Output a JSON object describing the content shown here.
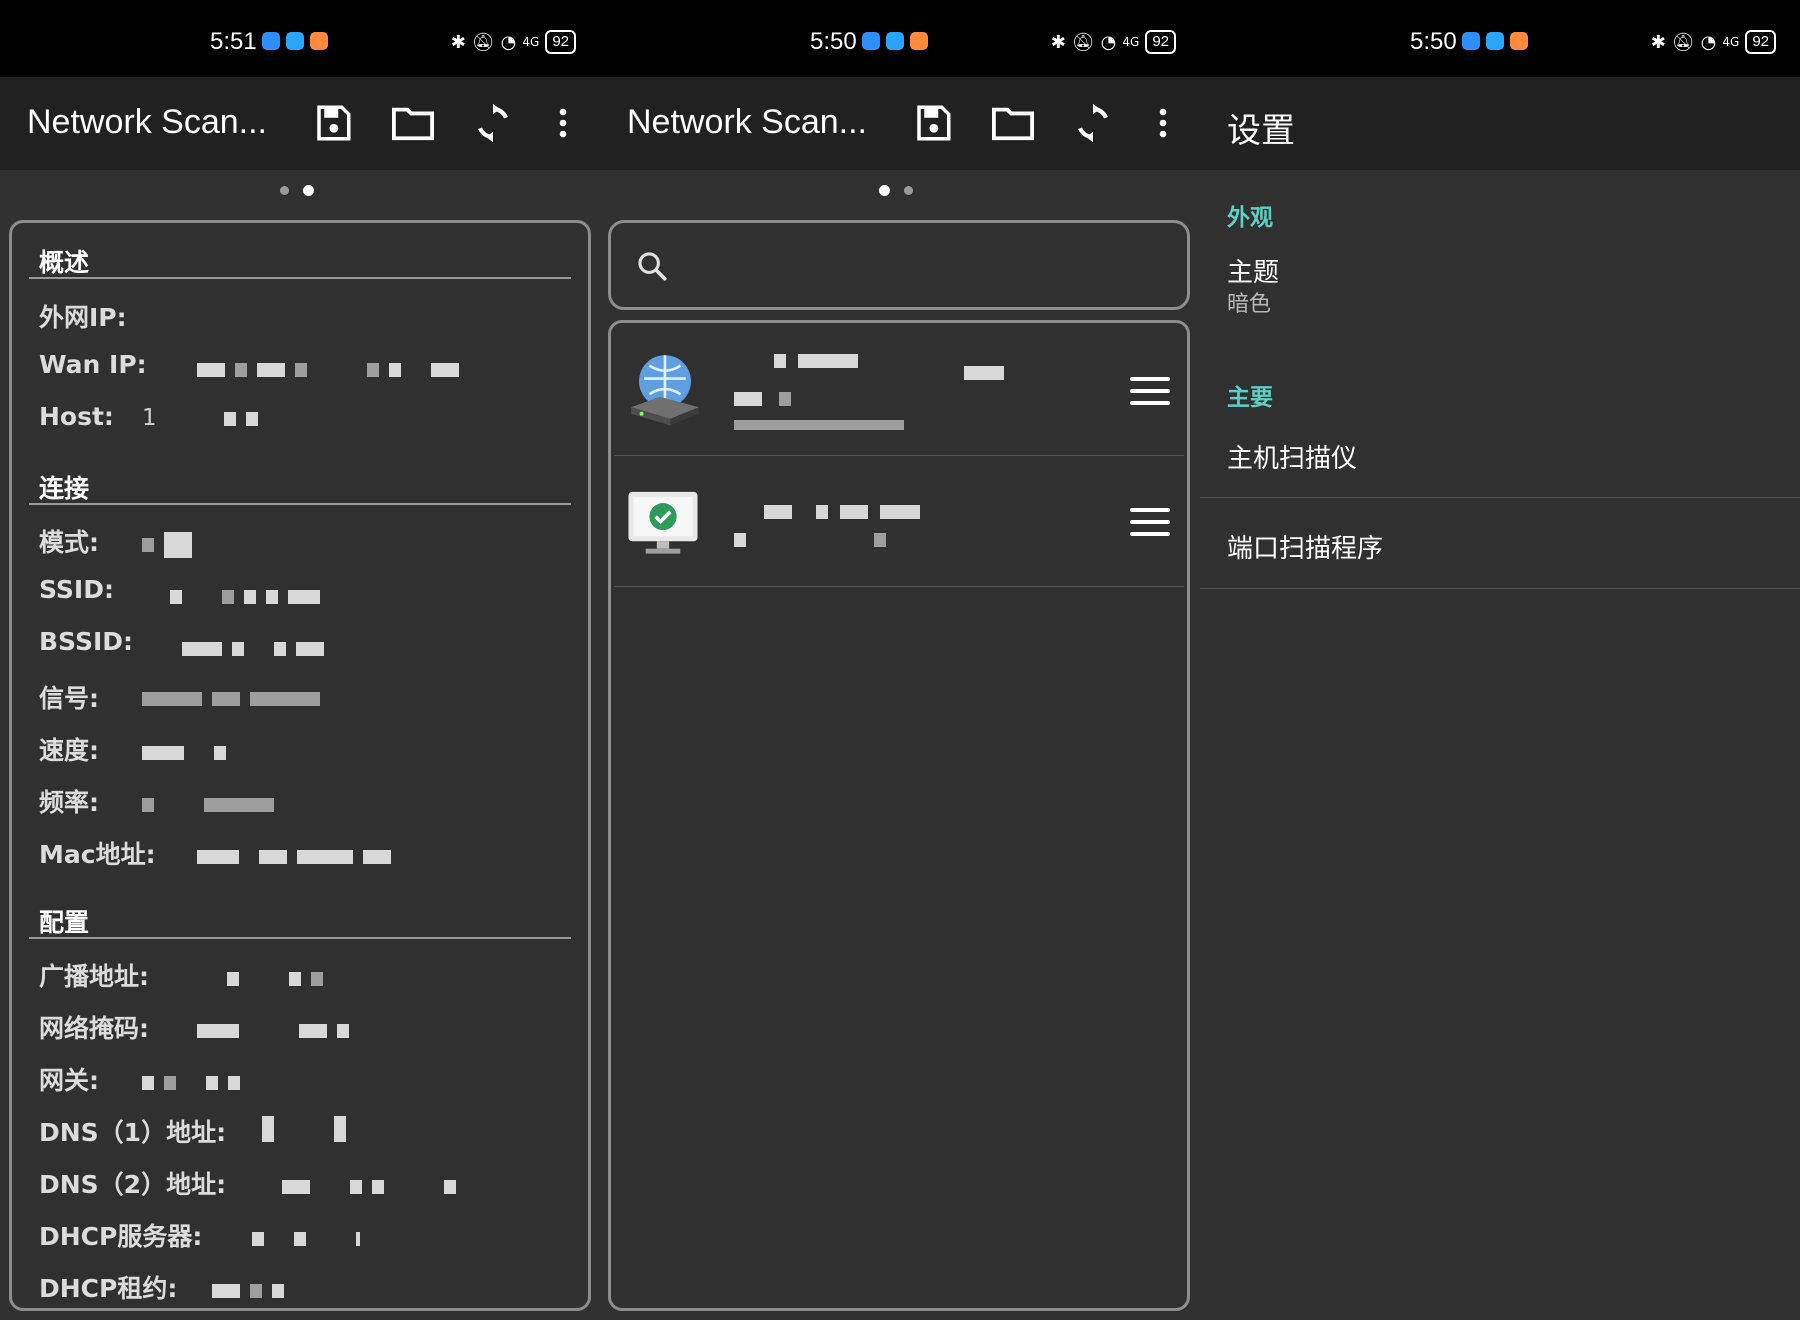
{
  "panels": [
    {
      "time": "5:51",
      "title": "Network Scan..."
    },
    {
      "time": "5:50",
      "title": "Network Scan..."
    },
    {
      "time": "5:50",
      "title": "设置"
    }
  ],
  "battery": "92",
  "network_label": "4G",
  "overview": {
    "title": "概述",
    "rows": [
      {
        "label": "外网IP:"
      },
      {
        "label": "Wan IP:"
      },
      {
        "label": "Host:",
        "value": "1"
      }
    ]
  },
  "connection": {
    "title": "连接",
    "rows": [
      {
        "label": "模式:"
      },
      {
        "label": "SSID:"
      },
      {
        "label": "BSSID:"
      },
      {
        "label": "信号:"
      },
      {
        "label": "速度:"
      },
      {
        "label": "频率:"
      },
      {
        "label": "Mac地址:"
      }
    ]
  },
  "config": {
    "title": "配置",
    "rows": [
      {
        "label": "广播地址:"
      },
      {
        "label": "网络掩码:"
      },
      {
        "label": "网关:"
      },
      {
        "label": "DNS（1）地址:"
      },
      {
        "label": "DNS（2）地址:"
      },
      {
        "label": "DHCP服务器:"
      },
      {
        "label": "DHCP租约:"
      }
    ]
  },
  "settings": {
    "appearance_cat": "外观",
    "theme_title": "主题",
    "theme_value": "暗色",
    "main_cat": "主要",
    "host_scanner": "主机扫描仪",
    "port_scanner": "端口扫描程序"
  },
  "colors": {
    "accent": "#5ed0c3",
    "toolbar": "#212121",
    "background": "#303030"
  }
}
